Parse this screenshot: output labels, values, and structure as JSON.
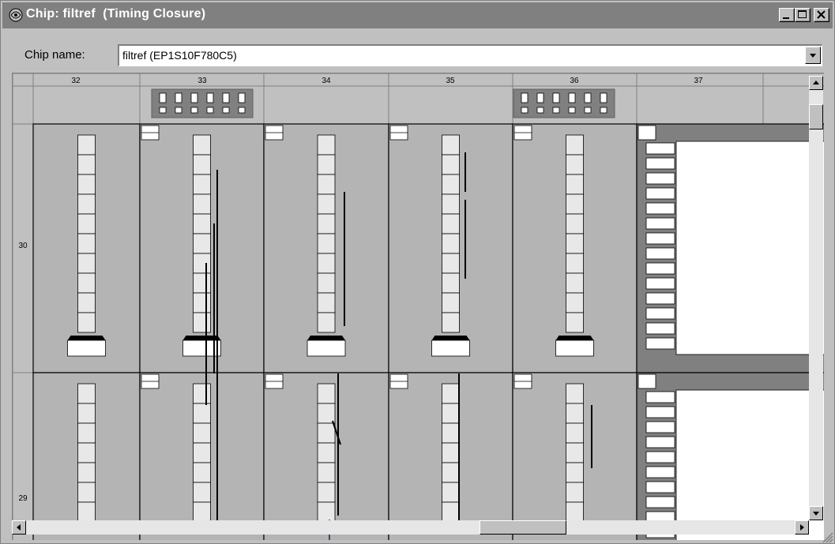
{
  "window": {
    "title": "Chip: filtref  (Timing Closure)",
    "controls": [
      "minimize",
      "maximize",
      "close"
    ]
  },
  "chip": {
    "label": "Chip name:",
    "value": "filtref (EP1S10F780C5)"
  },
  "floorplan": {
    "columns": [
      "32",
      "33",
      "34",
      "35",
      "36",
      "37"
    ],
    "rows": [
      "30",
      "29"
    ]
  },
  "colors": {
    "titlebar": "#808080",
    "face": "#c0c0c0",
    "cell": "#b4b4b4",
    "lab_fill": "#e8e8e8",
    "ram": "#808080"
  },
  "icons": {
    "title": "chip-icon",
    "scroll_up": "arrow-up-icon",
    "scroll_down": "arrow-down-icon",
    "scroll_left": "arrow-left-icon",
    "scroll_right": "arrow-right-icon",
    "dropdown": "chevron-down-icon",
    "resize": "resize-grip-icon"
  }
}
